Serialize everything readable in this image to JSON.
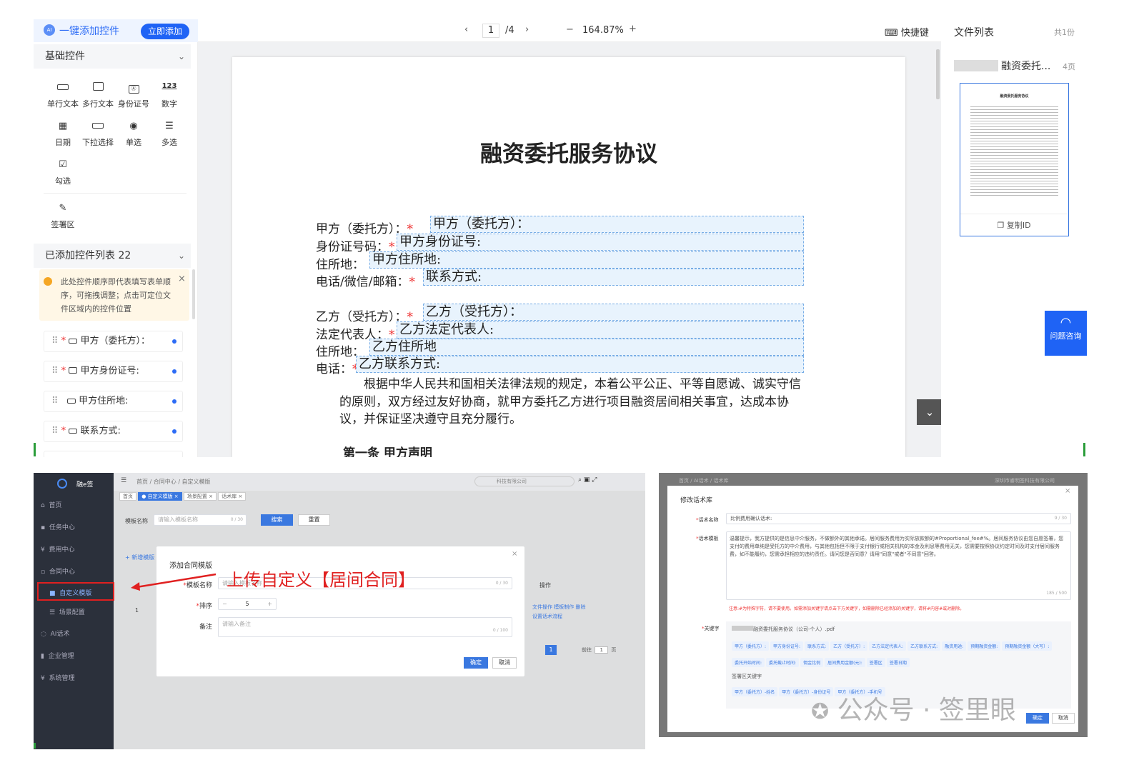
{
  "editor": {
    "quick_add_label": "一键添加控件",
    "quick_add_button": "立即添加",
    "basic_section": "基础控件",
    "controls": [
      {
        "label": "单行文本",
        "icon": "single-line-icon"
      },
      {
        "label": "多行文本",
        "icon": "multi-line-icon"
      },
      {
        "label": "身份证号",
        "icon": "id-card-icon"
      },
      {
        "label": "数字",
        "icon": "number-icon",
        "glyph": "123"
      },
      {
        "label": "日期",
        "icon": "calendar-icon"
      },
      {
        "label": "下拉选择",
        "icon": "dropdown-icon"
      },
      {
        "label": "单选",
        "icon": "radio-icon"
      },
      {
        "label": "多选",
        "icon": "checklist-icon"
      },
      {
        "label": "勾选",
        "icon": "checkbox-icon"
      }
    ],
    "sign_area": "签署区",
    "added_section": "已添加控件列表 22",
    "tip": "此处控件顺序即代表填写表单顺序，可拖拽调整；点击可定位文件区域内的控件位置",
    "added_items": [
      "甲方（委托方）：",
      "甲方身份证号:",
      "甲方住所地:",
      "联系方式:"
    ],
    "toolbar": {
      "page_current": "1",
      "page_total": "/4",
      "zoom": "164.87%",
      "shortcut": "快捷键"
    },
    "file_panel": {
      "title": "文件列表",
      "count": "共1份",
      "file_name": "融资委托...",
      "file_pages": "4页",
      "copy_id": "复制ID",
      "thumb_title": "融资委托服务协议"
    },
    "help": "问题咨询",
    "document": {
      "title": "融资委托服务协议",
      "rows": [
        {
          "label": "甲方（委托方）：",
          "field": "甲方（委托方）："
        },
        {
          "label": "身份证号码：",
          "field": "甲方身份证号:"
        },
        {
          "label": "住所地：",
          "field": "甲方住所地:"
        },
        {
          "label": "电话/微信/邮箱：",
          "field": "联系方式:"
        },
        {
          "label": "乙方（受托方）：",
          "field": "乙方（受托方）："
        },
        {
          "label": "法定代表人：",
          "field": "乙方法定代表人:"
        },
        {
          "label": "住所地：",
          "field": "乙方住所地"
        },
        {
          "label": "电话：",
          "field": "乙方联系方式:"
        }
      ],
      "paragraph": "根据中华人民共和国相关法律法规的规定，本着公平公正、平等自愿诚、诚实守信的原则，双方经过友好协商，就甲方委托乙方进行项目融资居间相关事宜，达成本协议，并保证坚决遵守且充分履行。",
      "section1": "第一条    甲方声明"
    }
  },
  "admin": {
    "logo": "融e签",
    "menu": [
      "首页",
      "任务中心",
      "费用中心",
      "合同中心",
      "自定义模版",
      "场景配置",
      "AI话术",
      "企业管理",
      "系统管理"
    ],
    "breadcrumb": "首页 / 合同中心 / 自定义模版",
    "company": "科技有限公司",
    "tabs": [
      "首页",
      "● 自定义模版 ×",
      "场景配置 ×",
      "话术库 ×"
    ],
    "search_label": "模板名称",
    "search_placeholder": "请输入模板名称",
    "search_count": "0 / 30",
    "search_btn": "搜索",
    "reset_btn": "重置",
    "new_btn": "+ 新增模版",
    "op_header": "操作",
    "row_actions": [
      "文件操作",
      "模板制作",
      "删除",
      "设置话术流程"
    ],
    "row_index": "1",
    "pager": {
      "page": "1",
      "goto": "前往",
      "goto_val": "1",
      "unit": "页"
    },
    "modal": {
      "title": "添加合同模版",
      "name_label": "模板名称",
      "name_placeholder": "请输入模板名称",
      "name_count": "0 / 30",
      "order_label": "排序",
      "order_value": "5",
      "note_label": "备注",
      "note_placeholder": "请输入备注",
      "note_count": "0 / 100",
      "ok": "确定",
      "cancel": "取消"
    },
    "annotation": "上传自定义【居间合同】"
  },
  "speech": {
    "breadcrumb": "首页 / AI话术 / 话术库",
    "company": "深圳市睿明签科技有限公司",
    "title": "修改话术库",
    "name_label": "话术名称",
    "name_value": "比例费用确认话术:",
    "name_count": "9 / 30",
    "tpl_label": "话术模板",
    "tpl_value": "温馨提示，我方提供的是信息中介服务，不做额外的其他承诺。居间服务费用为实际放款额的#Proportional_fee#%。居间服务协议由您自愿签署，您支付的费用单纯是受托方的中介费用，与其他包括但不限于支付银行或相关机构的本金及利息等费用无关，您需要按照协议约定时间及时支付居间服务费，如不能履约，您需承担相应的违约责任。请问您是否同意？请用\"同意\"或者\"不同意\"回答。",
    "tpl_count": "185 / 500",
    "warning": "注意:#为特殊字符，请不要使用。如需添加关键字请点击下方关键字，如需删除已经添加的关键字，请将#内容#或对删除。",
    "kw_label": "关键字",
    "file": "融资委托服务协议（公司-个人）.pdf",
    "keywords": [
      "甲方（委托方）:",
      "甲方身份证号:",
      "联系方式:",
      "乙方（受托方）:",
      "乙方法定代表人:",
      "乙方联系方式:",
      "融资用途:",
      "预期融资金额:",
      "预期融资金额（大写）:",
      "委托开始时间:",
      "委托截止时间:",
      "佣金比例",
      "居间费用金额(元):",
      "签署区",
      "签署日期"
    ],
    "sign_kw_label": "签署区关键字",
    "sign_keywords": [
      "甲方（委托方）-姓名",
      "甲方（委托方）-身份证号",
      "甲方（委托方）-手机号"
    ],
    "ok": "确定",
    "cancel": "取消"
  },
  "watermark": "公众号 · 签里眼"
}
